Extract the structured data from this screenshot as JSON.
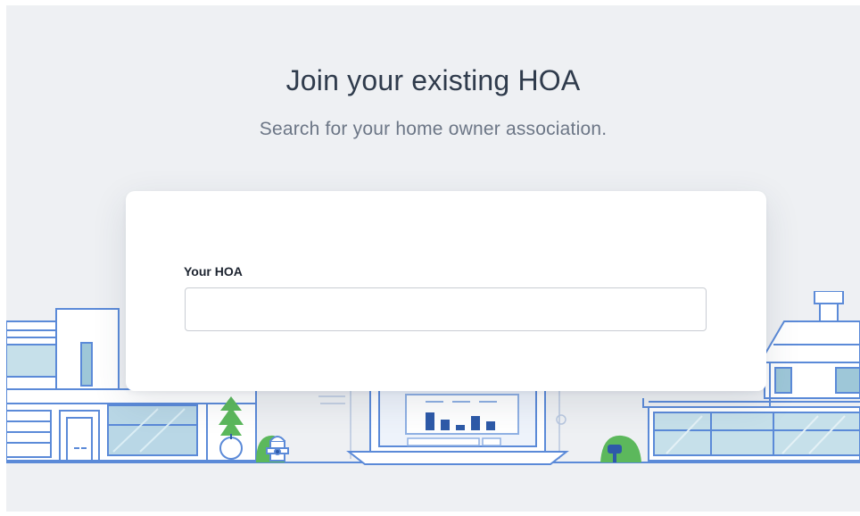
{
  "header": {
    "title": "Join your existing HOA",
    "subtitle": "Search for your home owner association."
  },
  "form": {
    "hoa_label": "Your HOA",
    "hoa_value": "",
    "hoa_placeholder": ""
  },
  "colors": {
    "background": "#eef0f3",
    "illustration_line": "#5b8ad8",
    "illustration_fill": "#dbe7fa",
    "accent_green": "#5cb85c",
    "accent_navy": "#2e5aa8"
  },
  "icons": [
    "house-illustration-left",
    "potted-plant-icon",
    "fire-hydrant-icon",
    "laptop-illustration",
    "mailbox-icon",
    "house-illustration-right"
  ]
}
